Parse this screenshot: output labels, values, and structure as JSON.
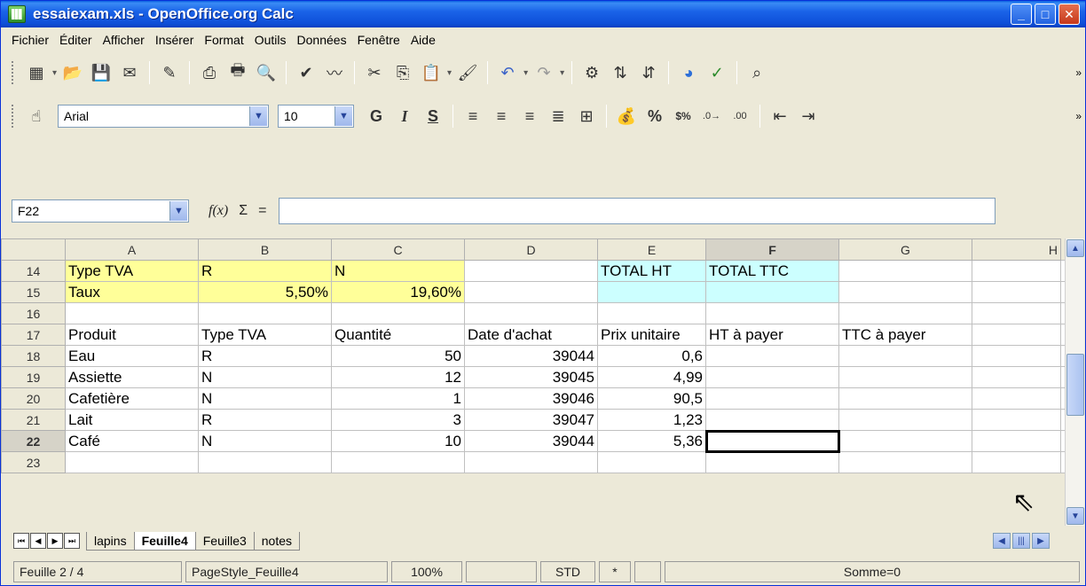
{
  "window": {
    "title": "essaiexam.xls - OpenOffice.org Calc",
    "min": "_",
    "max": "□",
    "close": "✕"
  },
  "menu": [
    "Fichier",
    "Éditer",
    "Afficher",
    "Insérer",
    "Format",
    "Outils",
    "Données",
    "Fenêtre",
    "Aide"
  ],
  "format_toolbar": {
    "font_name": "Arial",
    "font_size": "10",
    "bold": "G",
    "italic": "I",
    "underline": "S",
    "percent": "%",
    "currency": "$%"
  },
  "formula_bar": {
    "cell_ref": "F22",
    "func_wizard": "f(x)",
    "sum": "Σ",
    "equals": "="
  },
  "columns": [
    "A",
    "B",
    "C",
    "D",
    "E",
    "F",
    "G",
    "H"
  ],
  "rows": [
    {
      "n": "14",
      "cells": [
        "Type TVA",
        "R",
        "N",
        "",
        "TOTAL HT",
        "TOTAL TTC",
        "",
        ""
      ]
    },
    {
      "n": "15",
      "cells": [
        "Taux",
        "5,50%",
        "19,60%",
        "",
        "",
        "",
        "",
        ""
      ]
    },
    {
      "n": "16",
      "cells": [
        "",
        "",
        "",
        "",
        "",
        "",
        "",
        ""
      ]
    },
    {
      "n": "17",
      "cells": [
        "Produit",
        "Type TVA",
        "Quantité",
        "Date d'achat",
        "Prix unitaire",
        "HT à payer",
        "TTC à payer",
        ""
      ]
    },
    {
      "n": "18",
      "cells": [
        "Eau",
        "R",
        "50",
        "39044",
        "0,6",
        "",
        "",
        ""
      ]
    },
    {
      "n": "19",
      "cells": [
        "Assiette",
        "N",
        "12",
        "39045",
        "4,99",
        "",
        "",
        ""
      ]
    },
    {
      "n": "20",
      "cells": [
        "Cafetière",
        "N",
        "1",
        "39046",
        "90,5",
        "",
        "",
        ""
      ]
    },
    {
      "n": "21",
      "cells": [
        "Lait",
        "R",
        "3",
        "39047",
        "1,23",
        "",
        "",
        ""
      ]
    },
    {
      "n": "22",
      "cells": [
        "Café",
        "N",
        "10",
        "39044",
        "5,36",
        "",
        "",
        ""
      ]
    },
    {
      "n": "23",
      "cells": [
        "",
        "",
        "",
        "",
        "",
        "",
        "",
        ""
      ]
    }
  ],
  "sheets": [
    "lapins",
    "Feuille4",
    "Feuille3",
    "notes"
  ],
  "active_sheet": "Feuille4",
  "status": {
    "sheet": "Feuille 2 / 4",
    "style": "PageStyle_Feuille4",
    "zoom": "100%",
    "mode": "STD",
    "modified": "*",
    "sum": "Somme=0"
  }
}
